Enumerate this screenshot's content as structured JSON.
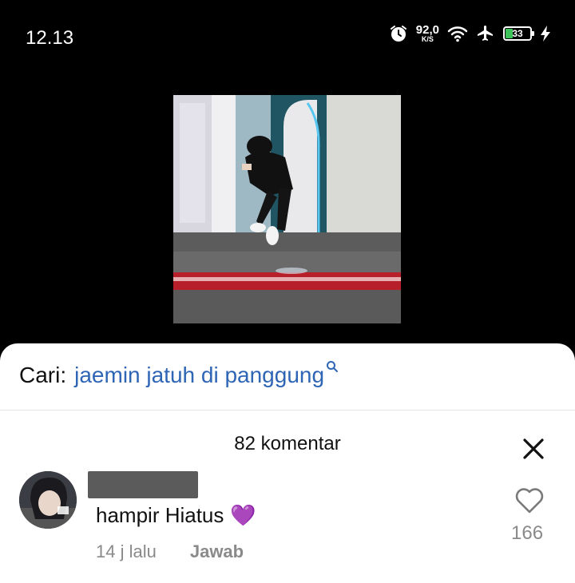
{
  "status_bar": {
    "time": "12.13",
    "network_speed_value": "92,0",
    "network_speed_unit": "K/S",
    "battery_level": "33",
    "icons": [
      "alarm-icon",
      "wifi-icon",
      "airplane-mode-icon",
      "battery-icon",
      "charging-bolt-icon"
    ],
    "battery_color": "#3ec35b"
  },
  "video": {
    "description_icon": "video-thumbnail"
  },
  "search": {
    "prefix": "Cari:",
    "query": "jaemin jatuh di panggung",
    "query_color": "#2f65b5"
  },
  "comments": {
    "count_label": "82 komentar",
    "items": [
      {
        "text": "hampir Hiatus",
        "emoji": "💜",
        "time": "14 j lalu",
        "reply_label": "Jawab",
        "likes": "166"
      }
    ]
  }
}
